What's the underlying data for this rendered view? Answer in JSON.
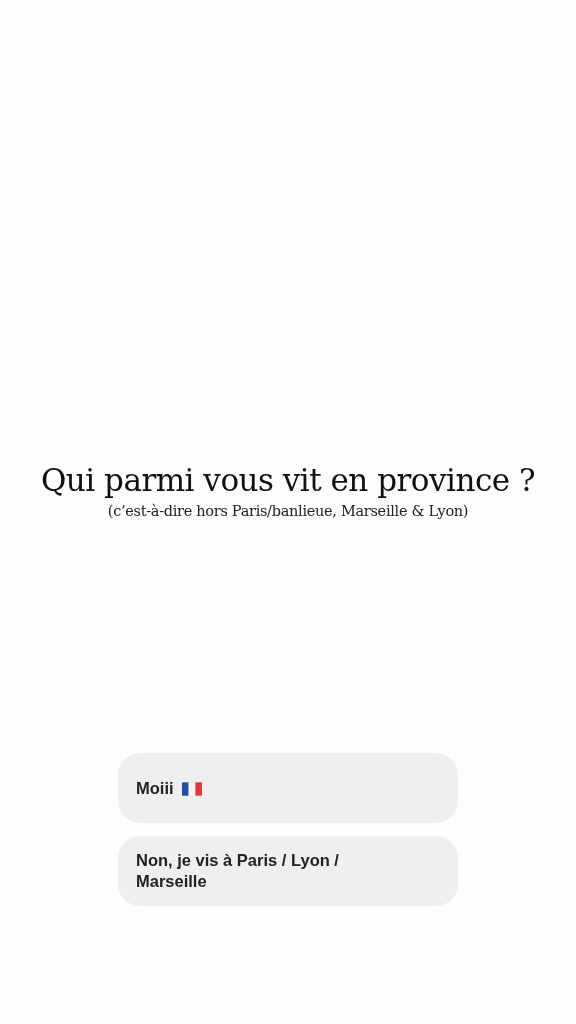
{
  "question": {
    "title": "Qui parmi vous vit en province ?",
    "subtitle": "(c’est-à-dire hors Paris/banlieue, Marseille & Lyon)"
  },
  "options": [
    {
      "kind": "flag",
      "label": "Moiii"
    },
    {
      "kind": "text",
      "label": "Non, je vis à Paris / Lyon / Marseille"
    }
  ]
}
